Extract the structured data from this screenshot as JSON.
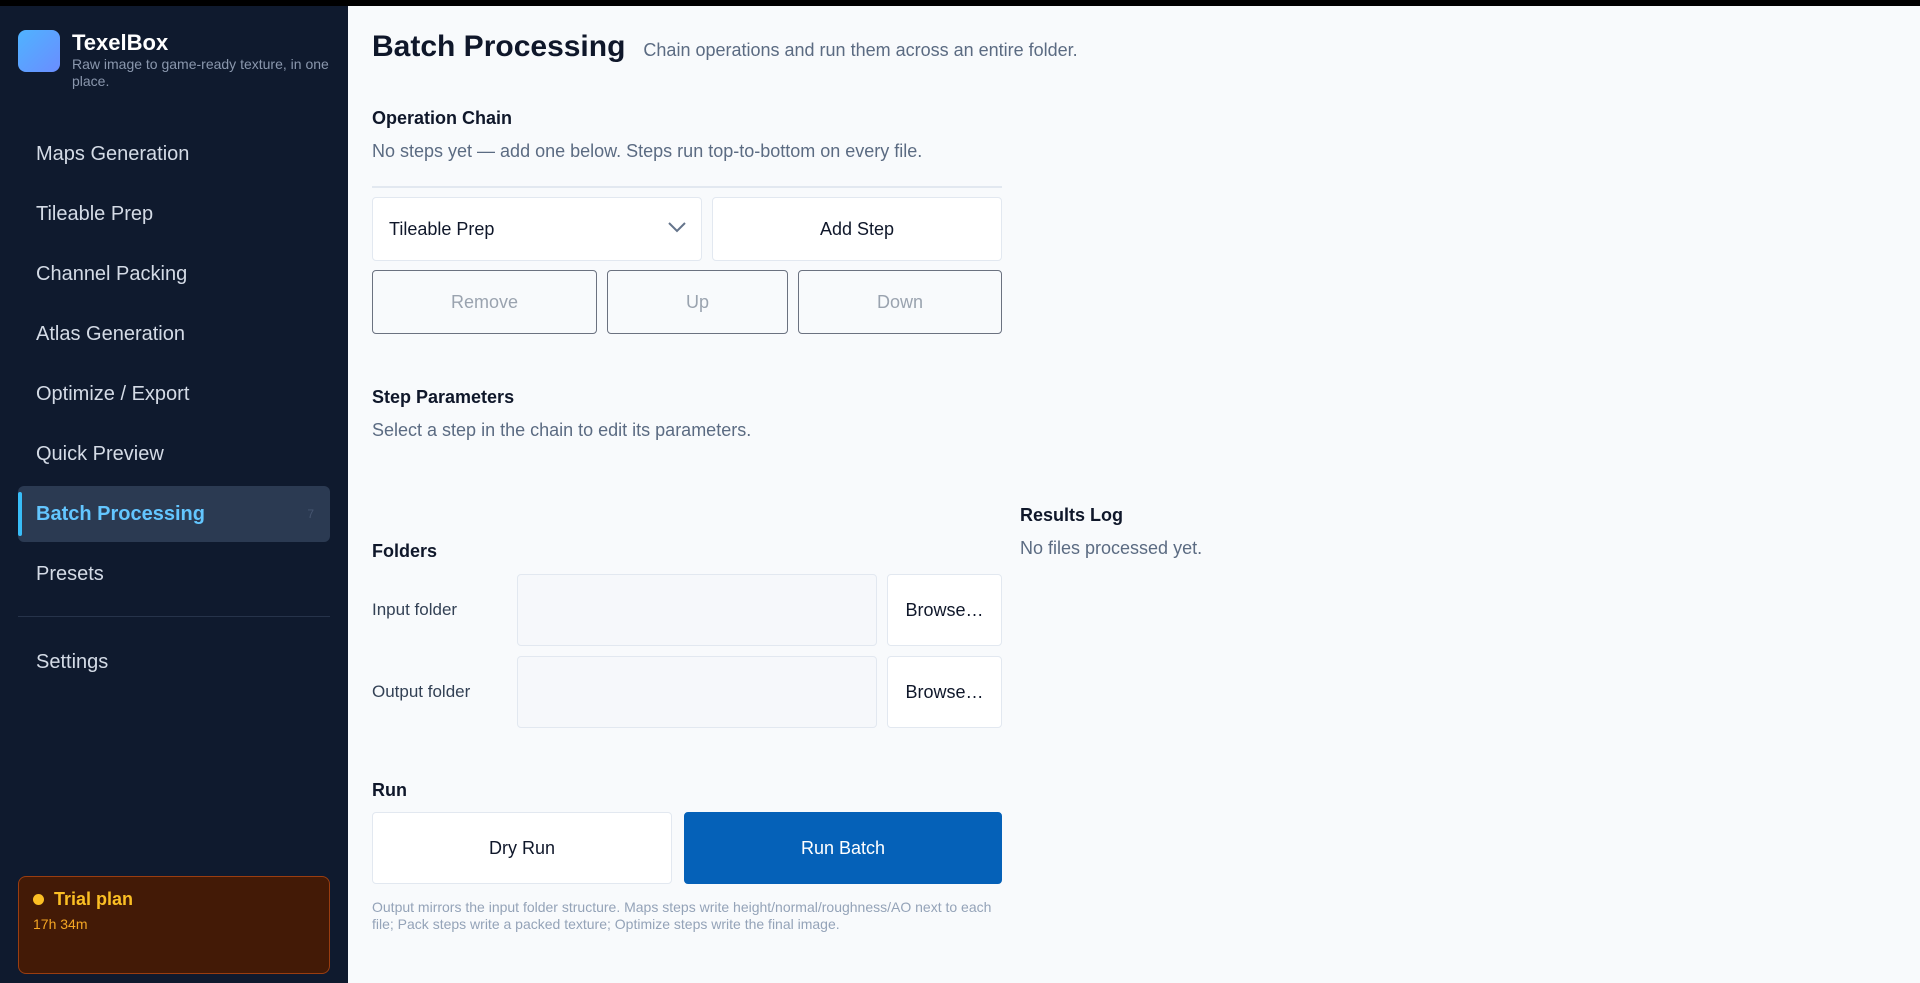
{
  "app": {
    "name": "TexelBox",
    "tagline": "Raw image to game-ready texture, in one place."
  },
  "sidebar": {
    "items": [
      {
        "label": "Maps Generation"
      },
      {
        "label": "Tileable Prep"
      },
      {
        "label": "Channel Packing"
      },
      {
        "label": "Atlas Generation"
      },
      {
        "label": "Optimize / Export"
      },
      {
        "label": "Quick Preview"
      },
      {
        "label": "Batch Processing",
        "shortcut": "7",
        "active": true
      },
      {
        "label": "Presets"
      }
    ],
    "settings_label": "Settings",
    "trial": {
      "title": "Trial plan",
      "time_left": "17h 34m"
    }
  },
  "page": {
    "title": "Batch Processing",
    "subtitle": "Chain operations and run them across an entire folder."
  },
  "chain": {
    "title": "Operation Chain",
    "empty_hint": "No steps yet — add one below. Steps run top-to-bottom on every file.",
    "selected_operation": "Tileable Prep",
    "add_label": "Add Step",
    "remove_label": "Remove",
    "up_label": "Up",
    "down_label": "Down"
  },
  "params": {
    "title": "Step Parameters",
    "hint": "Select a step in the chain to edit its parameters."
  },
  "folders": {
    "title": "Folders",
    "input_label": "Input folder",
    "input_value": "",
    "output_label": "Output folder",
    "output_value": "",
    "browse_label": "Browse…"
  },
  "run": {
    "title": "Run",
    "dry_run_label": "Dry Run",
    "run_batch_label": "Run Batch",
    "note": "Output mirrors the input folder structure. Maps steps write height/normal/roughness/AO next to each file; Pack steps write a packed texture; Optimize steps write the final image."
  },
  "results": {
    "title": "Results Log",
    "empty": "No files processed yet."
  },
  "colors": {
    "sidebar_bg": "#0f1a2e",
    "accent": "#38bdf8",
    "primary": "#0561b8",
    "trial_bg": "#431a06",
    "trial_text": "#fbbf24"
  }
}
